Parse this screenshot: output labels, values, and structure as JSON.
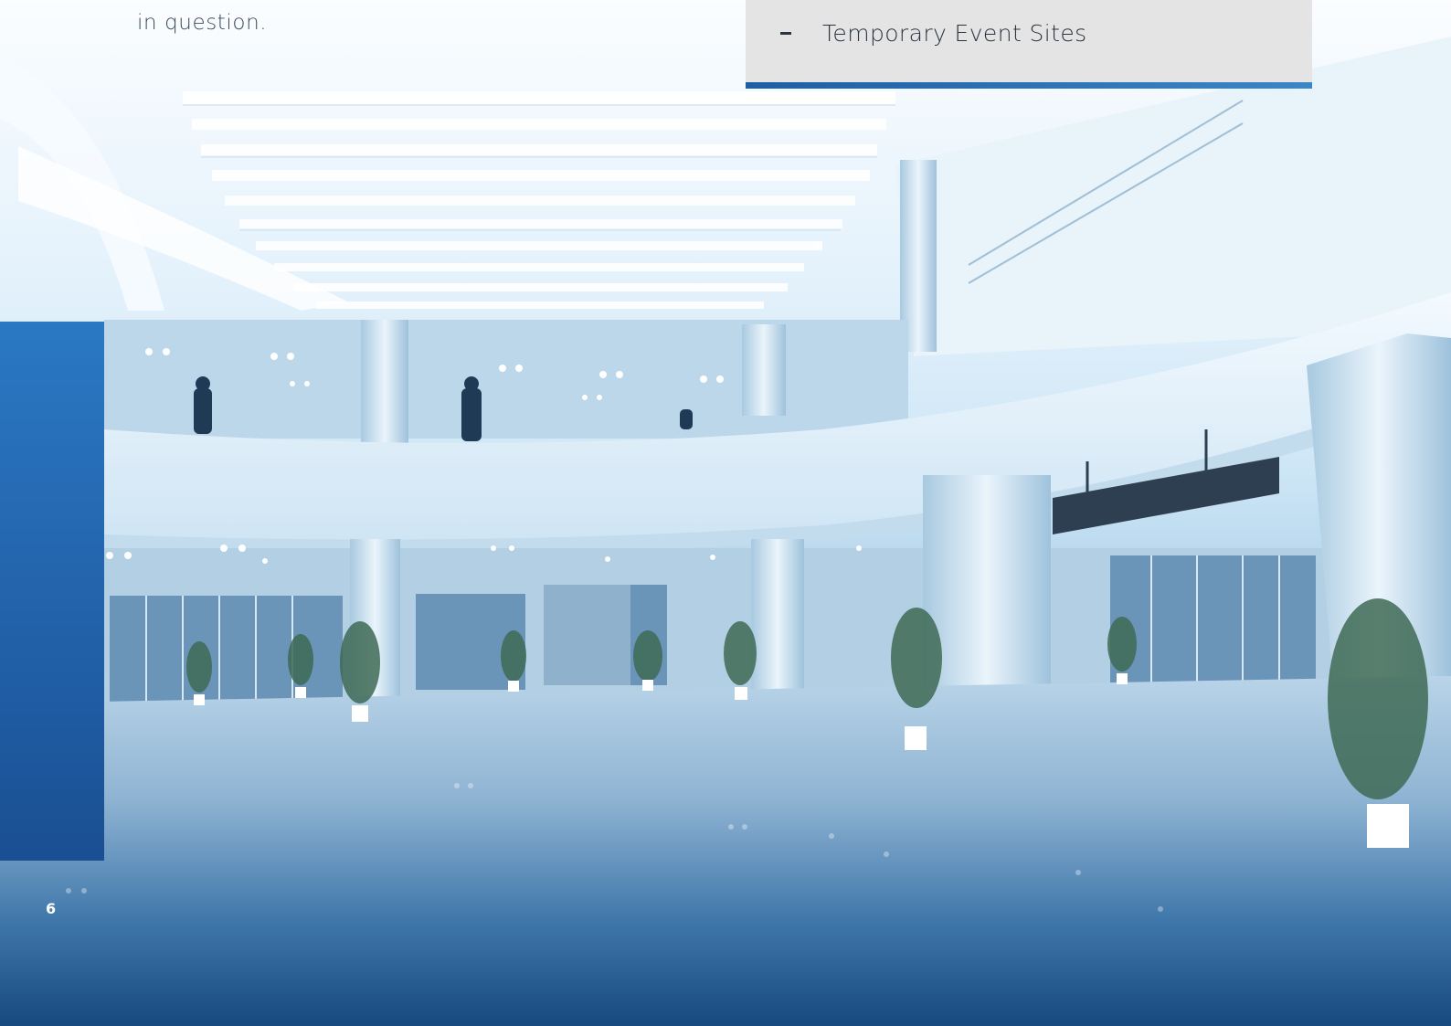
{
  "intro": {
    "text": "in question."
  },
  "list": {
    "items": [
      {
        "label": "Temporary Event Sites"
      }
    ]
  },
  "page": {
    "number": "6"
  },
  "colors": {
    "accent": "#2262aa",
    "box": "#e4e4e5",
    "underline": "#1d5fa6"
  },
  "photo": {
    "subject": "modern atrium interior with curved upper gallery, columns and potted plants, blue tint"
  }
}
